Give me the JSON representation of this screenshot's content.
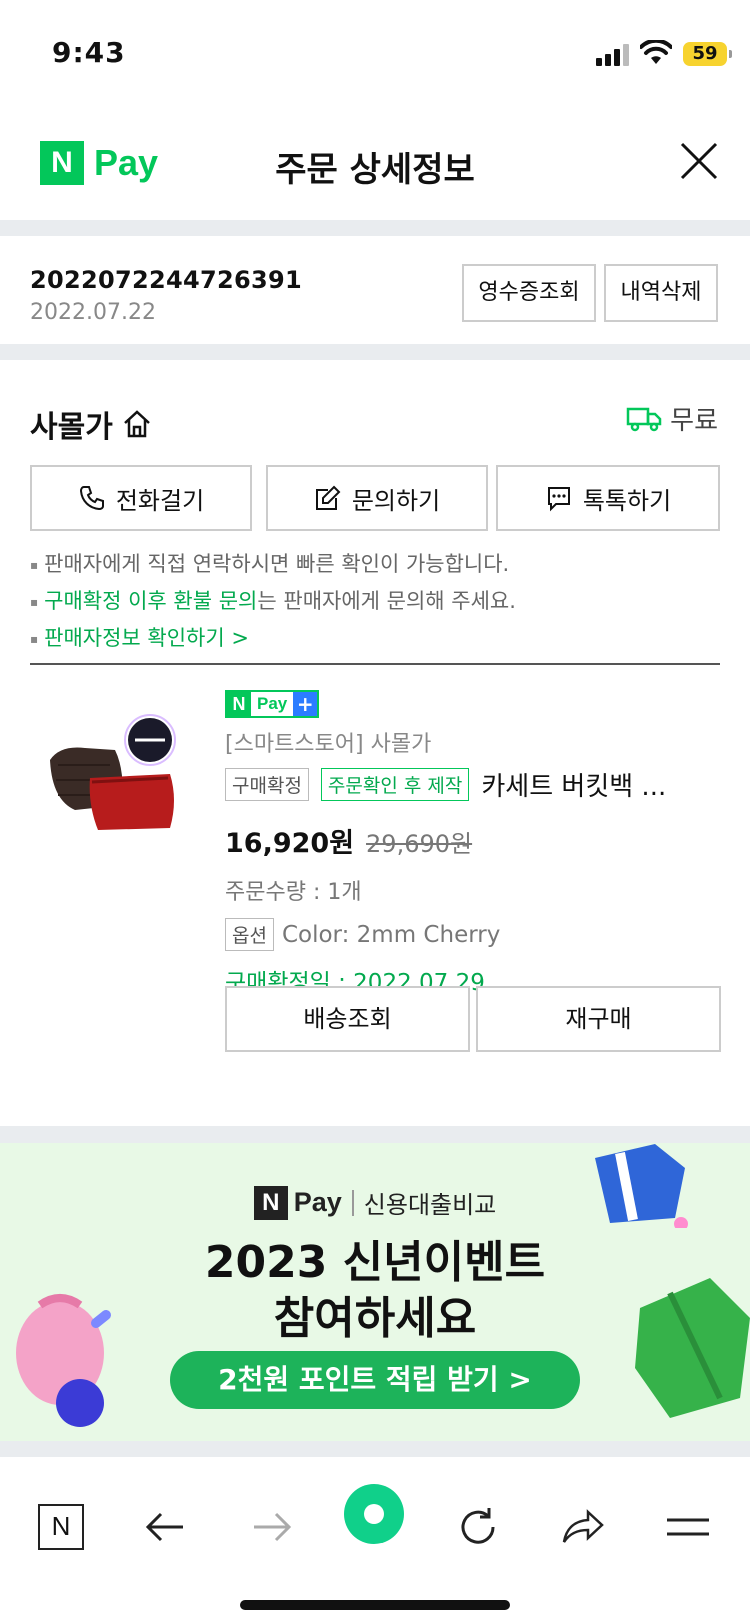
{
  "status_bar": {
    "time": "9:43",
    "battery": "59"
  },
  "header": {
    "logo_n": "N",
    "logo_pay": "Pay",
    "title": "주문 상세정보"
  },
  "order": {
    "number": "2022072244726391",
    "date": "2022.07.22",
    "receipt_label": "영수증조회",
    "delete_label": "내역삭제"
  },
  "seller": {
    "name": "사몰가",
    "shipping": "무료",
    "call_label": "전화걸기",
    "inquiry_label": "문의하기",
    "talk_label": "톡톡하기",
    "notes": {
      "line1": "판매자에게 직접 연락하시면 빠른 확인이 가능합니다.",
      "line2_green": "구매확정 이후 환불 문의",
      "line2_rest": "는 판매자에게 문의해 주세요.",
      "line3": "판매자정보 확인하기 >"
    }
  },
  "product": {
    "badge_n": "N",
    "badge_pay": "Pay",
    "badge_plus": "+",
    "store": "[스마트스토어] 사몰가",
    "tag_confirm": "구매확정",
    "tag_made": "주문확인 후 제작",
    "name": "카세트 버킷백 ...",
    "price": "16,920원",
    "original_price": "29,690원",
    "quantity": "주문수량 : 1개",
    "option_tag": "옵션",
    "option_value": "Color: 2mm Cherry",
    "confirm_date": "구매확정일 : 2022.07.29",
    "tracking_label": "배송조회",
    "rebuy_label": "재구매"
  },
  "banner": {
    "brand_n": "N",
    "brand_pay": "Pay",
    "brand_sub": "신용대출비교",
    "headline1": "2023 신년이벤트",
    "headline2": "참여하세요",
    "cta": "2천원 포인트 적립 받기 >"
  },
  "toolbar": {
    "home_label": "N",
    "icons": [
      "naver-home-icon",
      "back-arrow-icon",
      "forward-arrow-icon",
      "green-dot-icon",
      "refresh-icon",
      "share-icon",
      "menu-icon"
    ]
  },
  "colors": {
    "brand_green": "#03c75a",
    "text_green": "#03a94e",
    "banner_bg": "#e8f9e6",
    "cta_green": "#1db35a"
  }
}
